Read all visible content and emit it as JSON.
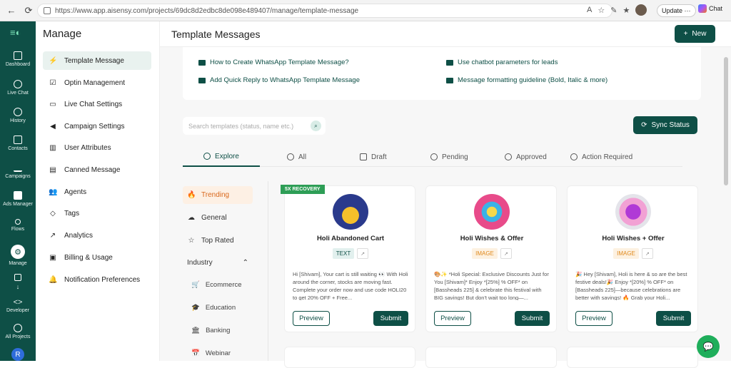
{
  "browser": {
    "url": "https://www.app.aisensy.com/projects/69dc8d2edbc8de098e489407/manage/template-message",
    "update_label": "Update",
    "chat_label": "Chat"
  },
  "rail": {
    "items": [
      {
        "label": "Dashboard",
        "icon": "dashboard-icon"
      },
      {
        "label": "Live Chat",
        "icon": "chat-icon"
      },
      {
        "label": "History",
        "icon": "history-icon"
      },
      {
        "label": "Contacts",
        "icon": "contacts-icon"
      },
      {
        "label": "Campaigns",
        "icon": "campaigns-icon"
      },
      {
        "label": "Ads Manager",
        "icon": "facebook-icon"
      },
      {
        "label": "Flows",
        "icon": "flows-icon"
      },
      {
        "label": "Manage",
        "icon": "gear-icon"
      },
      {
        "label": "Developer",
        "icon": "code-icon"
      },
      {
        "label": "All Projects",
        "icon": "projects-icon"
      }
    ],
    "avatar": "R"
  },
  "sidebar": {
    "title": "Manage",
    "items": [
      {
        "label": "Template Message",
        "icon": "bolt-icon"
      },
      {
        "label": "Optin Management",
        "icon": "checkbox-icon"
      },
      {
        "label": "Live Chat Settings",
        "icon": "chat-icon"
      },
      {
        "label": "Campaign Settings",
        "icon": "megaphone-icon"
      },
      {
        "label": "User Attributes",
        "icon": "columns-icon"
      },
      {
        "label": "Canned Message",
        "icon": "book-icon"
      },
      {
        "label": "Agents",
        "icon": "users-icon"
      },
      {
        "label": "Tags",
        "icon": "tag-icon"
      },
      {
        "label": "Analytics",
        "icon": "trend-icon"
      },
      {
        "label": "Billing & Usage",
        "icon": "billing-icon"
      },
      {
        "label": "Notification Preferences",
        "icon": "bell-icon"
      }
    ]
  },
  "header": {
    "title": "Template Messages",
    "new_label": "New"
  },
  "help_links": [
    "How to Create WhatsApp Template Message?",
    "Use chatbot parameters for leads",
    "Add Quick Reply to WhatsApp Template Message",
    "Message formatting guideline (Bold, Italic & more)"
  ],
  "search": {
    "placeholder": "Search templates (status, name etc.)"
  },
  "sync_label": "Sync Status",
  "tabs": [
    "Explore",
    "All",
    "Draft",
    "Pending",
    "Approved",
    "Action Required"
  ],
  "categories": {
    "main": [
      "Trending",
      "General",
      "Top Rated"
    ],
    "industry_label": "Industry",
    "industry": [
      "Ecommerce",
      "Education",
      "Banking",
      "Webinar"
    ]
  },
  "cards": [
    {
      "badge": "5X RECOVERY",
      "title": "Holi Abandoned Cart",
      "tag": "TEXT",
      "body": "Hi [Shivam], Your cart is still waiting 👀 With Holi around the corner, stocks are moving fast. Complete your order now and use code HOLI20 to get 20% OFF + Free...",
      "preview": "Preview",
      "submit": "Submit"
    },
    {
      "badge": "",
      "title": "Holi Wishes & Offer",
      "tag": "IMAGE",
      "body": "🎨✨ *Holi Special: Exclusive Discounts Just for You [Shivam]* Enjoy *[25%] % OFF* on [Bassheads 225] & celebrate this festival with BIG savings! But don't wait too long—...",
      "preview": "Preview",
      "submit": "Submit"
    },
    {
      "badge": "",
      "title": "Holi Wishes + Offer",
      "tag": "IMAGE",
      "body": "🎉 Hey [Shivam], Holi is here & so are the best festive deals!🎉 Enjoy *[20%] % OFF* on [Bassheads 225]—because celebrations are better with savings! 🔥 Grab your Holi...",
      "preview": "Preview",
      "submit": "Submit"
    }
  ],
  "colors": {
    "brand": "#0e4f46",
    "trending": "#d9681c",
    "badge": "#2e9e56"
  }
}
